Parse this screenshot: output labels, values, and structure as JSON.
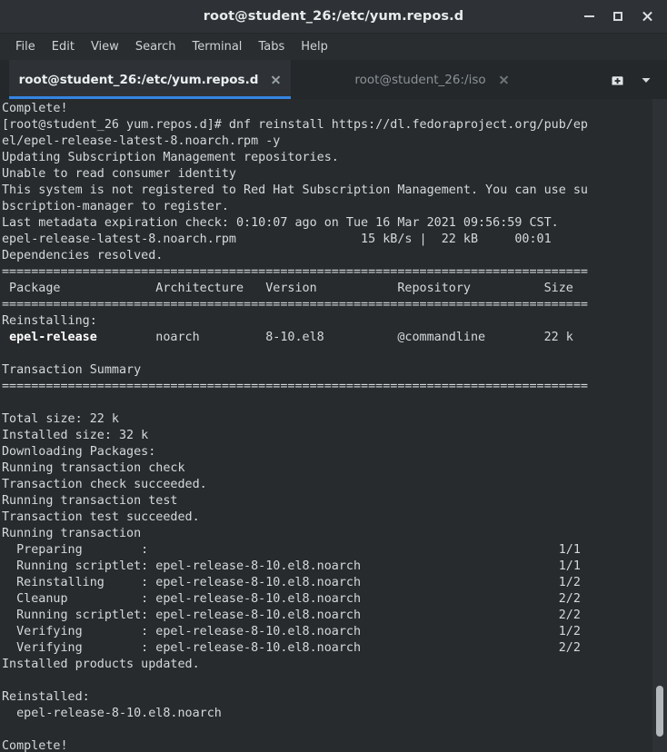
{
  "window": {
    "title": "root@student_26:/etc/yum.repos.d",
    "controls": [
      {
        "name": "minimize",
        "label": "–"
      },
      {
        "name": "maximize",
        "label": "□"
      },
      {
        "name": "close",
        "label": "×"
      }
    ]
  },
  "menubar": {
    "items": [
      "File",
      "Edit",
      "View",
      "Search",
      "Terminal",
      "Tabs",
      "Help"
    ]
  },
  "tabbar": {
    "tabs": [
      {
        "label": "root@student_26:/etc/yum.repos.d",
        "active": true
      },
      {
        "label": "root@student_26:/iso",
        "active": false
      }
    ],
    "new_tab_icon": "new-tab-icon",
    "tab_list_icon": "chevron-down-icon"
  },
  "theme": {
    "titlebar_bg": "#2e3236",
    "menubar_bg": "#292d30",
    "tabbar_bg": "#24282b",
    "terminal_bg": "#272b2e",
    "terminal_fg": "#d6d9db",
    "accent": "#3584e4",
    "scrollbar_thumb": "#b2b8bc"
  },
  "terminal": {
    "prompt": "[root@student_26 yum.repos.d]#",
    "command": "dnf reinstall https://dl.fedoraproject.org/pub/epel/epel-release-latest-8.noarch.rpm -y",
    "separator": "================================================================================",
    "table": {
      "headers": [
        "Package",
        "Architecture",
        "Version",
        "Repository",
        "Size"
      ],
      "section": "Reinstalling:",
      "rows": [
        {
          "package": "epel-release",
          "architecture": "noarch",
          "version": "8-10.el8",
          "repository": "@commandline",
          "size": "22 k",
          "bold": true
        }
      ]
    },
    "summary": {
      "heading": "Transaction Summary",
      "total_size": "Total size: 22 k",
      "installed_size": "Installed size: 32 k"
    },
    "download": {
      "file": "epel-release-latest-8.noarch.rpm",
      "rate": "15 kB/s",
      "size": "22 kB",
      "time": "00:01"
    },
    "metadata_line": "Last metadata expiration check: 0:10:07 ago on Tue 16 Mar 2021 09:56:59 CST.",
    "steps": [
      {
        "action": "Preparing",
        "target": "",
        "counter": "1/1"
      },
      {
        "action": "Running scriptlet",
        "target": "epel-release-8-10.el8.noarch",
        "counter": "1/1"
      },
      {
        "action": "Reinstalling",
        "target": "epel-release-8-10.el8.noarch",
        "counter": "1/2"
      },
      {
        "action": "Cleanup",
        "target": "epel-release-8-10.el8.noarch",
        "counter": "2/2"
      },
      {
        "action": "Running scriptlet",
        "target": "epel-release-8-10.el8.noarch",
        "counter": "2/2"
      },
      {
        "action": "Verifying",
        "target": "epel-release-8-10.el8.noarch",
        "counter": "1/2"
      },
      {
        "action": "Verifying",
        "target": "epel-release-8-10.el8.noarch",
        "counter": "2/2"
      }
    ],
    "reinstalled": {
      "heading": "Reinstalled:",
      "package": "epel-release-8-10.el8.noarch"
    },
    "messages": [
      "Complete!",
      "Updating Subscription Management repositories.",
      "Unable to read consumer identity",
      "This system is not registered to Red Hat Subscription Management. You can use subscription-manager to register.",
      "Dependencies resolved.",
      "Downloading Packages:",
      "Running transaction check",
      "Transaction check succeeded.",
      "Running transaction test",
      "Transaction test succeeded.",
      "Running transaction",
      "Installed products updated.",
      "Complete!"
    ],
    "screen_lines": [
      "Complete!",
      "[root@student_26 yum.repos.d]# dnf reinstall https://dl.fedoraproject.org/pub/ep",
      "el/epel-release-latest-8.noarch.rpm -y",
      "Updating Subscription Management repositories.",
      "Unable to read consumer identity",
      "This system is not registered to Red Hat Subscription Management. You can use su",
      "bscription-manager to register.",
      "Last metadata expiration check: 0:10:07 ago on Tue 16 Mar 2021 09:56:59 CST.",
      "epel-release-latest-8.noarch.rpm                 15 kB/s |  22 kB     00:01",
      "Dependencies resolved.",
      "================================================================================",
      " Package             Architecture   Version           Repository          Size",
      "================================================================================",
      "Reinstalling:",
      " epel-release        noarch         8-10.el8          @commandline        22 k",
      "",
      "Transaction Summary",
      "================================================================================",
      "",
      "Total size: 22 k",
      "Installed size: 32 k",
      "Downloading Packages:",
      "Running transaction check",
      "Transaction check succeeded.",
      "Running transaction test",
      "Transaction test succeeded.",
      "Running transaction",
      "  Preparing        :                                                        1/1",
      "  Running scriptlet: epel-release-8-10.el8.noarch                           1/1",
      "  Reinstalling     : epel-release-8-10.el8.noarch                           1/2",
      "  Cleanup          : epel-release-8-10.el8.noarch                           2/2",
      "  Running scriptlet: epel-release-8-10.el8.noarch                           2/2",
      "  Verifying        : epel-release-8-10.el8.noarch                           1/2",
      "  Verifying        : epel-release-8-10.el8.noarch                           2/2",
      "Installed products updated.",
      "",
      "Reinstalled:",
      "  epel-release-8-10.el8.noarch",
      "",
      "Complete!"
    ],
    "bold_line_index": 14,
    "bold_text": "epel-release"
  }
}
